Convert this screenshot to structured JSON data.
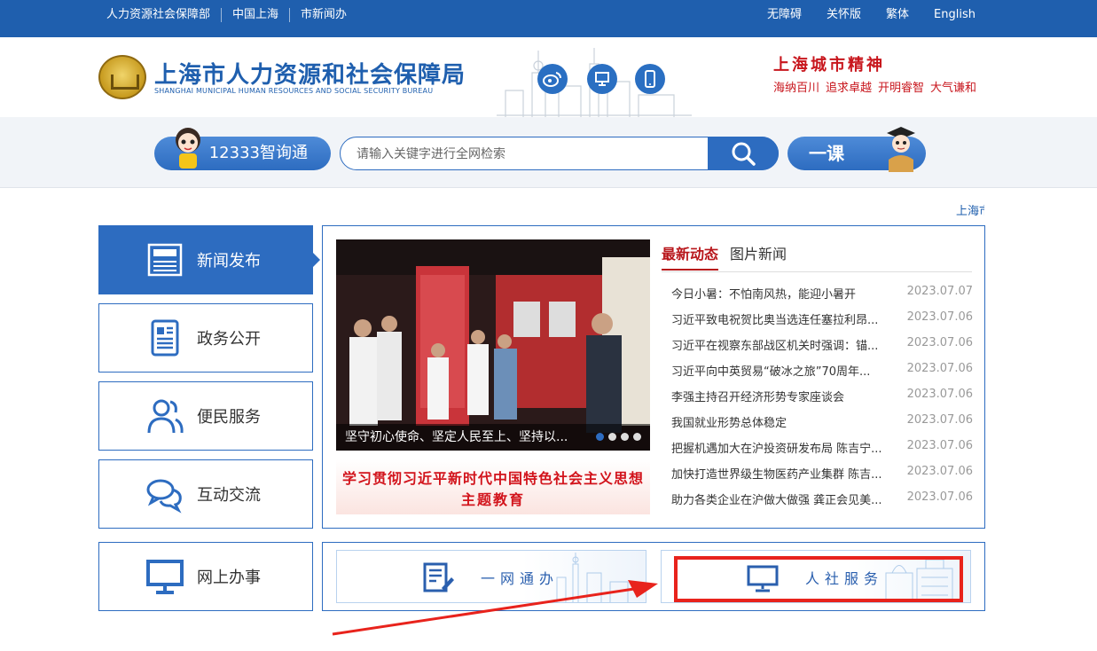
{
  "topbar": {
    "links": [
      "人力资源社会保障部",
      "中国上海",
      "市新闻办"
    ],
    "right": [
      "无障碍",
      "关怀版",
      "繁体",
      "English"
    ]
  },
  "header": {
    "title_cn": "上海市人力资源和社会保障局",
    "title_en": "SHANGHAI MUNICIPAL HUMAN RESOURCES AND SOCIAL SECURITY BUREAU",
    "social_icons": [
      "weibo-icon",
      "monitor-icon",
      "mobile-icon"
    ],
    "spirit_title": "上海城市精神",
    "spirit_words": [
      "海纳百川",
      "追求卓越",
      "开明睿智",
      "大气谦和"
    ]
  },
  "search": {
    "hotline_label": "12333智询通",
    "placeholder": "请输入关键字进行全网检索",
    "course_label": "一课"
  },
  "ticker": "上海市",
  "nav": [
    {
      "label": "新闻发布",
      "icon": "newspaper-icon"
    },
    {
      "label": "政务公开",
      "icon": "document-icon"
    },
    {
      "label": "便民服务",
      "icon": "users-icon"
    },
    {
      "label": "互动交流",
      "icon": "chat-icon"
    },
    {
      "label": "网上办事",
      "icon": "monitor-icon"
    }
  ],
  "news": {
    "photo_caption": "坚守初心使命、坚定人民至上、坚持以...",
    "banner_line1": "学习贯彻习近平新时代中国特色社会主义思想",
    "banner_line2": "主题教育",
    "tabs": [
      "最新动态",
      "图片新闻"
    ],
    "items": [
      {
        "title": "今日小暑：不怕南风热，能迎小暑开",
        "date": "2023.07.07"
      },
      {
        "title": "习近平致电祝贺比奥当选连任塞拉利昂...",
        "date": "2023.07.06"
      },
      {
        "title": "习近平在视察东部战区机关时强调：锚...",
        "date": "2023.07.06"
      },
      {
        "title": "习近平向中英贸易“破冰之旅”70周年...",
        "date": "2023.07.06"
      },
      {
        "title": "李强主持召开经济形势专家座谈会",
        "date": "2023.07.06"
      },
      {
        "title": "我国就业形势总体稳定",
        "date": "2023.07.06"
      },
      {
        "title": "把握机遇加大在沪投资研发布局 陈吉宁...",
        "date": "2023.07.06"
      },
      {
        "title": "加快打造世界级生物医药产业集群 陈吉...",
        "date": "2023.07.06"
      },
      {
        "title": "助力各类企业在沪做大做强 龚正会见美...",
        "date": "2023.07.06"
      }
    ]
  },
  "services": [
    {
      "label": "一网通办",
      "icon": "form-edit-icon"
    },
    {
      "label": "人社服务",
      "icon": "monitor-icon"
    }
  ],
  "colors": {
    "brand_blue": "#1f5fae",
    "accent_red": "#c8161d",
    "highlight_red": "#e8231c"
  }
}
